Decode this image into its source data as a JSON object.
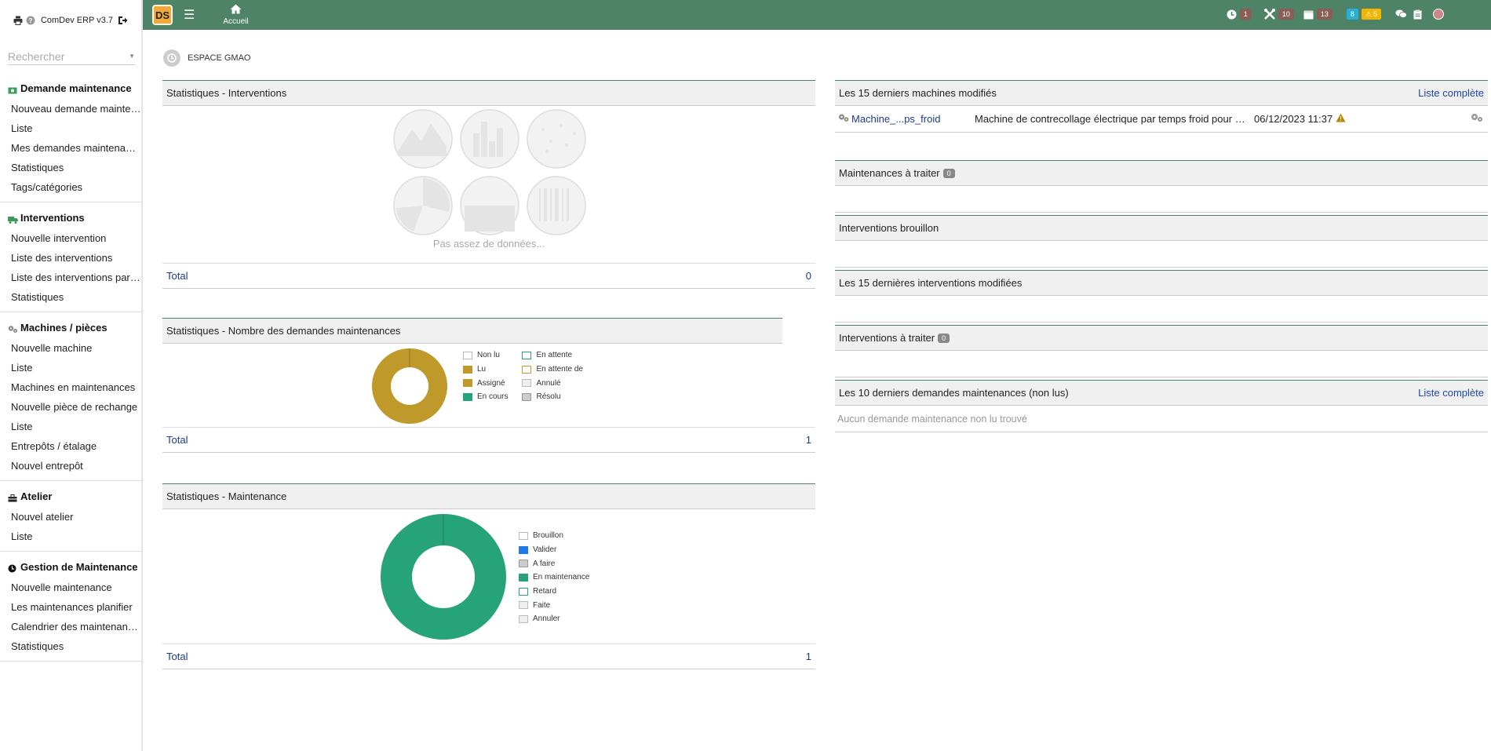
{
  "app": {
    "title": "ComDev ERP v3.7",
    "logo_text": "DS",
    "home_label": "Accueil",
    "space_title": "ESPACE GMAO"
  },
  "search": {
    "placeholder": "Rechercher"
  },
  "sidebar": {
    "groups": [
      {
        "title": "Demande maintenance",
        "icon": "money-icon",
        "items": [
          "Nouveau demande maintenance",
          "Liste",
          "Mes demandes maintenances",
          "Statistiques",
          "Tags/catégories"
        ]
      },
      {
        "title": "Interventions",
        "icon": "truck-icon",
        "items": [
          "Nouvelle intervention",
          "Liste des interventions",
          "Liste des interventions par tiers",
          "Statistiques"
        ]
      },
      {
        "title": "Machines / pièces",
        "icon": "gears-icon",
        "items": [
          "Nouvelle machine",
          "Liste",
          "Machines en maintenances",
          "Nouvelle pièce de rechange",
          "Liste",
          "Entrepôts / étalage",
          "Nouvel entrepôt"
        ]
      },
      {
        "title": "Atelier",
        "icon": "toolbox-icon",
        "items": [
          "Nouvel atelier",
          "Liste"
        ]
      },
      {
        "title": "Gestion de Maintenance",
        "icon": "clock-icon",
        "items": [
          "Nouvelle maintenance",
          "Les maintenances planifier",
          "Calendrier des maintenances",
          "Statistiques"
        ]
      }
    ]
  },
  "topbar": {
    "badges": [
      {
        "icon": "clock-icon",
        "value": "1",
        "color": "#8a5d55"
      },
      {
        "icon": "tools-icon",
        "value": "10",
        "color": "#8a5d55"
      },
      {
        "icon": "calendar-icon",
        "value": "13",
        "color": "#8a5d55"
      },
      {
        "icon": "",
        "value": "8",
        "color": "#28b0d8"
      },
      {
        "icon": "warning-icon",
        "value": "5",
        "color": "#f2b705"
      }
    ]
  },
  "panels": {
    "interventions_stats": {
      "title": "Statistiques - Interventions",
      "no_data": "Pas assez de données...",
      "total_label": "Total",
      "total_value": "0"
    },
    "demandes_stats": {
      "title": "Statistiques - Nombre des demandes maintenances",
      "total_label": "Total",
      "total_value": "1",
      "legend": [
        {
          "label": "Non lu",
          "color": "#ffffff",
          "border": "#bbbbbb"
        },
        {
          "label": "Lu",
          "color": "#bf9a2b",
          "border": "#bf9a2b"
        },
        {
          "label": "Assigné",
          "color": "#bf9a2b",
          "border": "#bf9a2b"
        },
        {
          "label": "En cours",
          "color": "#27a37a",
          "border": "#27a37a"
        },
        {
          "label": "En attente",
          "color": "#ffffff",
          "border": "#27a37a"
        },
        {
          "label": "En attente de",
          "color": "#ffffff",
          "border": "#bf9a2b"
        },
        {
          "label": "Annulé",
          "color": "#eeeeee",
          "border": "#bbbbbb"
        },
        {
          "label": "Résolu",
          "color": "#cccccc",
          "border": "#999999"
        }
      ]
    },
    "maintenance_stats": {
      "title": "Statistiques - Maintenance",
      "total_label": "Total",
      "total_value": "1",
      "legend": [
        {
          "label": "Brouillon",
          "color": "#ffffff",
          "border": "#bbbbbb"
        },
        {
          "label": "Valider",
          "color": "#1e7be6",
          "border": "#1e7be6"
        },
        {
          "label": "A faire",
          "color": "#cccccc",
          "border": "#999999"
        },
        {
          "label": "En maintenance",
          "color": "#27a37a",
          "border": "#27a37a"
        },
        {
          "label": "Retard",
          "color": "#ffffff",
          "border": "#27a37a"
        },
        {
          "label": "Faite",
          "color": "#eeeeee",
          "border": "#bbbbbb"
        },
        {
          "label": "Annuler",
          "color": "#eeeeee",
          "border": "#bbbbbb"
        }
      ]
    },
    "machines": {
      "title": "Les 15 derniers machines modifiés",
      "link": "Liste complète",
      "rows": [
        {
          "ref": "Machine_...ps_froid",
          "desc": "Machine de contrecollage électrique par temps froid pour papier",
          "date": "06/12/2023 11:37"
        }
      ]
    },
    "maint_to_process": {
      "title": "Maintenances à traiter",
      "count": "0"
    },
    "interv_draft": {
      "title": "Interventions brouillon"
    },
    "last_interv": {
      "title": "Les 15 dernières interventions modifiées"
    },
    "interv_to_process": {
      "title": "Interventions à traiter",
      "count": "0"
    },
    "last_demands": {
      "title": "Les 10 derniers demandes maintenances (non lus)",
      "link": "Liste complète",
      "empty": "Aucun demande maintenance non lu trouvé"
    }
  },
  "chart_data": [
    {
      "type": "pie",
      "title": "Statistiques - Nombre des demandes maintenances",
      "categories": [
        "Non lu",
        "Lu",
        "Assigné",
        "En cours",
        "En attente",
        "En attente de",
        "Annulé",
        "Résolu"
      ],
      "values": [
        0,
        1,
        0,
        0,
        0,
        0,
        0,
        0
      ],
      "colors": [
        "#ffffff",
        "#bf9a2b",
        "#bf9a2b",
        "#27a37a",
        "#ffffff",
        "#ffffff",
        "#eeeeee",
        "#cccccc"
      ],
      "donut": true
    },
    {
      "type": "pie",
      "title": "Statistiques - Maintenance",
      "categories": [
        "Brouillon",
        "Valider",
        "A faire",
        "En maintenance",
        "Retard",
        "Faite",
        "Annuler"
      ],
      "values": [
        0,
        0,
        0,
        1,
        0,
        0,
        0
      ],
      "colors": [
        "#ffffff",
        "#1e7be6",
        "#cccccc",
        "#27a37a",
        "#ffffff",
        "#eeeeee",
        "#eeeeee"
      ],
      "donut": true
    }
  ]
}
